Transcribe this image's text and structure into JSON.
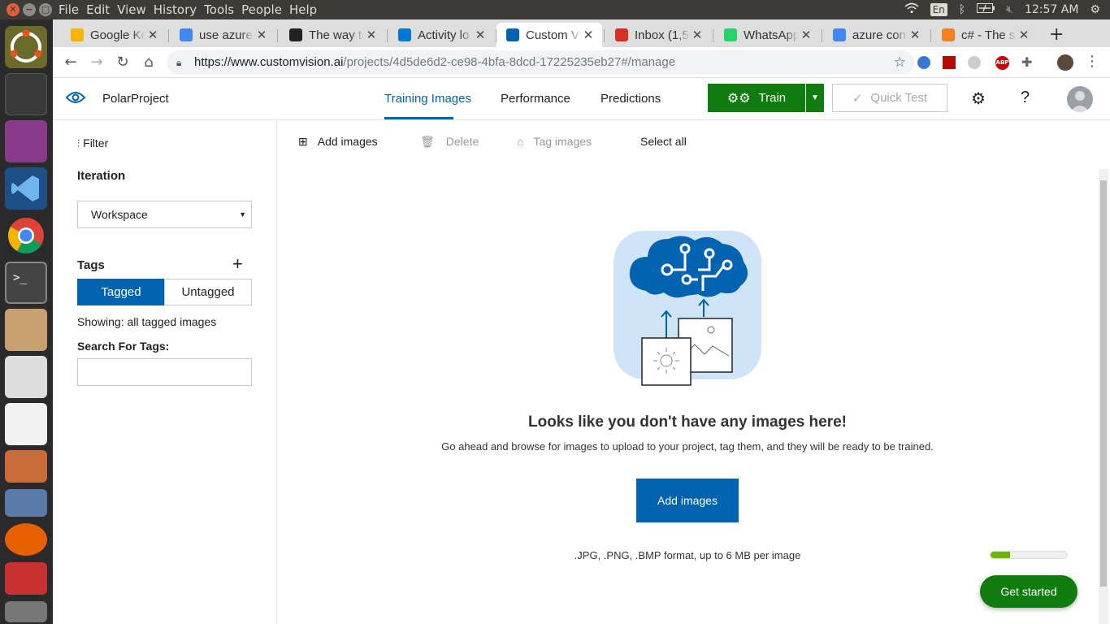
{
  "os": {
    "menus": [
      "File",
      "Edit",
      "View",
      "History",
      "Tools",
      "People",
      "Help"
    ],
    "keyboard": "En",
    "clock": "12:57 AM"
  },
  "browser": {
    "tabs": [
      {
        "title": "Google Ke",
        "icon": "google-keep-icon",
        "color": "#f4b400"
      },
      {
        "title": "use azure",
        "icon": "google-icon",
        "color": "#4285f4"
      },
      {
        "title": "The way to",
        "icon": "github-icon",
        "color": "#222222"
      },
      {
        "title": "Activity lo",
        "icon": "azure-icon",
        "color": "#0078d4"
      },
      {
        "title": "Custom Vi",
        "icon": "custom-vision-icon",
        "color": "#0063b1",
        "active": true
      },
      {
        "title": "Inbox (1,5",
        "icon": "gmail-icon",
        "color": "#d93025"
      },
      {
        "title": "WhatsApp",
        "icon": "whatsapp-icon",
        "color": "#25d366"
      },
      {
        "title": "azure conf",
        "icon": "google-icon",
        "color": "#4285f4"
      },
      {
        "title": "c# - The sp",
        "icon": "stackoverflow-icon",
        "color": "#f48024"
      }
    ],
    "url_host": "https://www.customvision.ai",
    "url_path": "/projects/4d5de6d2-ce98-4bfa-8dcd-17225235eb27#/manage"
  },
  "app": {
    "project_name": "PolarProject",
    "nav": {
      "training": "Training Images",
      "performance": "Performance",
      "predictions": "Predictions"
    },
    "train_label": "Train",
    "quick_test_label": "Quick Test",
    "sidebar": {
      "filter": "Filter",
      "iteration_heading": "Iteration",
      "iteration_value": "Workspace",
      "tags_heading": "Tags",
      "tagged": "Tagged",
      "untagged": "Untagged",
      "showing": "Showing: all tagged images",
      "search_label": "Search For Tags:",
      "search_value": ""
    },
    "toolbar": {
      "add_images": "Add images",
      "delete": "Delete",
      "tag_images": "Tag images",
      "select_all": "Select all"
    },
    "empty": {
      "title": "Looks like you don't have any images here!",
      "body": "Go ahead and browse for images to upload to your project, tag them, and they will be ready to be trained.",
      "button": "Add images",
      "formats": ".JPG, .PNG, .BMP format, up to 6 MB per image"
    },
    "get_started": "Get started",
    "progress": 0.25,
    "colors": {
      "accent": "#0063b1",
      "train": "#107c10",
      "progress": "#6bb700"
    }
  }
}
